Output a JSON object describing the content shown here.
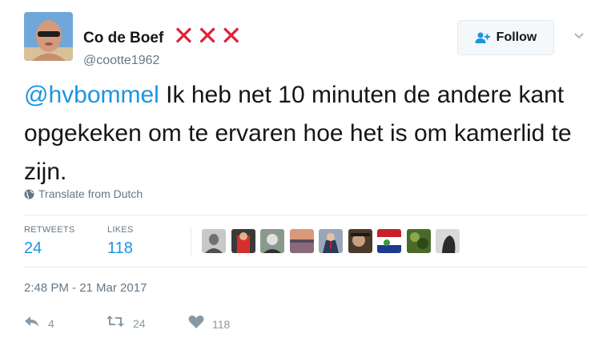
{
  "user": {
    "display_name": "Co de Boef",
    "name_emoji": "✕✕✕",
    "handle": "@cootte1962"
  },
  "follow_button": {
    "label": "Follow"
  },
  "tweet": {
    "mention": "@hvbommel",
    "text": " Ik heb net 10 minuten de andere kant opgekeken om te ervaren hoe het is om kamerlid te zijn."
  },
  "translate": {
    "label": "Translate from Dutch"
  },
  "stats": {
    "retweets_label": "RETWEETS",
    "retweets_value": "24",
    "likes_label": "LIKES",
    "likes_value": "118"
  },
  "timestamp": "2:48 PM - 21 Mar 2017",
  "actions": {
    "reply_count": "4",
    "retweet_count": "24",
    "like_count": "118"
  },
  "colors": {
    "link": "#1b95e0",
    "secondary_text": "#657786",
    "emoji_red": "#e0203a"
  },
  "icons": {
    "follow": "add-user-icon",
    "caret": "chevron-down-icon",
    "translate": "globe-icon",
    "reply": "reply-icon",
    "retweet": "retweet-icon",
    "like": "heart-icon"
  }
}
